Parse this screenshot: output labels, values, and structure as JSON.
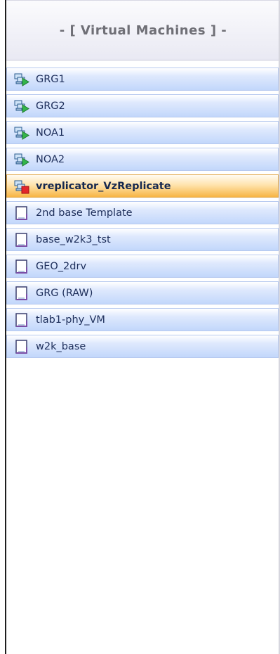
{
  "panel": {
    "title": "- [ Virtual Machines ] -"
  },
  "colors": {
    "item_gradient_top": "#ffffff",
    "item_gradient_bottom": "#c2d7fb",
    "selected_gradient_bottom": "#f7b544",
    "label_text": "#1d2e5a"
  },
  "vms": [
    {
      "label": "GRG1",
      "icon": "vm-running-icon",
      "selected": false
    },
    {
      "label": "GRG2",
      "icon": "vm-running-icon",
      "selected": false
    },
    {
      "label": "NOA1",
      "icon": "vm-running-icon",
      "selected": false
    },
    {
      "label": "NOA2",
      "icon": "vm-running-icon",
      "selected": false
    },
    {
      "label": "vreplicator_VzReplicate",
      "icon": "vm-stopped-icon",
      "selected": true
    },
    {
      "label": "2nd base Template",
      "icon": "template-icon",
      "selected": false
    },
    {
      "label": "base_w2k3_tst",
      "icon": "template-icon",
      "selected": false
    },
    {
      "label": "GEO_2drv",
      "icon": "template-icon",
      "selected": false
    },
    {
      "label": "GRG (RAW)",
      "icon": "template-icon",
      "selected": false
    },
    {
      "label": "tlab1-phy_VM",
      "icon": "template-icon",
      "selected": false
    },
    {
      "label": "w2k_base",
      "icon": "template-icon",
      "selected": false
    }
  ]
}
